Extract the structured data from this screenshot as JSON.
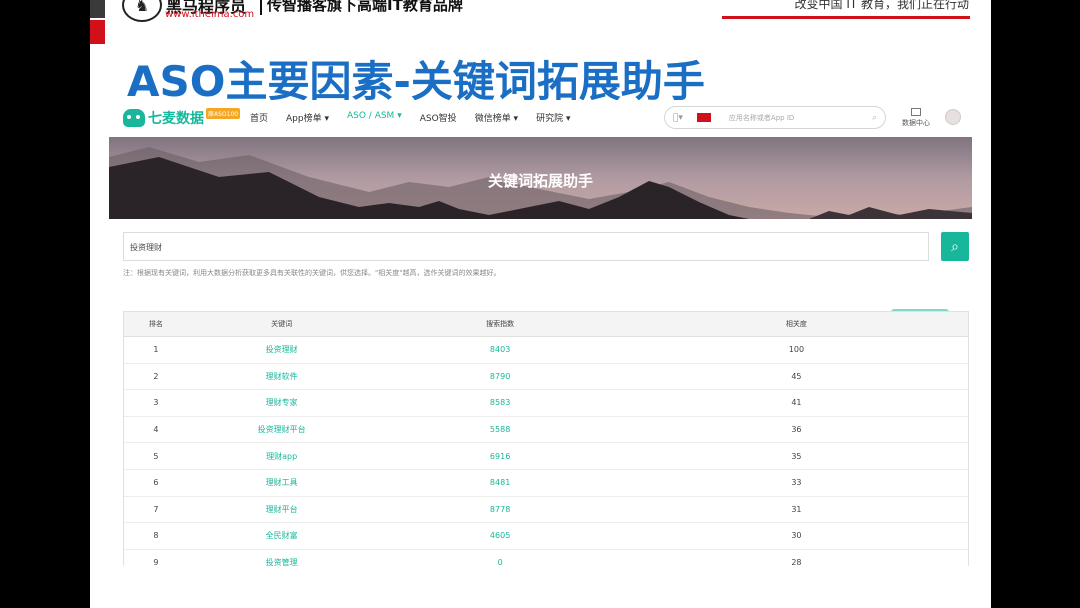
{
  "slide": {
    "brand_name": "黑马程序员",
    "brand_url": "www.itheima.com",
    "brand_slogan": "传智播客旗下高端IT教育品牌",
    "right_slogan": "改变中国 IT 教育，我们正在行动",
    "title": "ASO主要因素-关键词拓展助手"
  },
  "site": {
    "logo_name": "七麦数据",
    "logo_badge": "原ASO100",
    "nav": [
      "首页",
      "App榜单 ▾",
      "ASO / ASM ▾",
      "ASO智投",
      "微信榜单 ▾",
      "研究院 ▾"
    ],
    "nav_active_index": 2,
    "search_placeholder": "应用名称或者App ID",
    "platform_icon": "apple-icon",
    "country": "CN",
    "data_center_label": "数据中心"
  },
  "banner": {
    "title": "关键词拓展助手"
  },
  "tool": {
    "input_value": "投资理财",
    "note": "注：根据现有关键词，利用大数据分析获取更多具有关联性的关键词，供您选择。\"相关度\"越高，选作关键词的效果越好。"
  },
  "table": {
    "headers": [
      "排名",
      "关键词",
      "搜索指数",
      "相关度"
    ],
    "rows": [
      {
        "rank": "1",
        "keyword": "投资理财",
        "index": "8403",
        "relevance": "100"
      },
      {
        "rank": "2",
        "keyword": "理财软件",
        "index": "8790",
        "relevance": "45"
      },
      {
        "rank": "3",
        "keyword": "理财专家",
        "index": "8583",
        "relevance": "41"
      },
      {
        "rank": "4",
        "keyword": "投资理财平台",
        "index": "5588",
        "relevance": "36"
      },
      {
        "rank": "5",
        "keyword": "理财app",
        "index": "6916",
        "relevance": "35"
      },
      {
        "rank": "6",
        "keyword": "理财工具",
        "index": "8481",
        "relevance": "33"
      },
      {
        "rank": "7",
        "keyword": "理财平台",
        "index": "8778",
        "relevance": "31"
      },
      {
        "rank": "8",
        "keyword": "全民财富",
        "index": "4605",
        "relevance": "30"
      },
      {
        "rank": "9",
        "keyword": "投资管理",
        "index": "0",
        "relevance": "28"
      }
    ]
  },
  "colors": {
    "accent": "#18b69a",
    "title_blue": "#1a6fc4",
    "brand_red": "#d0111b"
  }
}
